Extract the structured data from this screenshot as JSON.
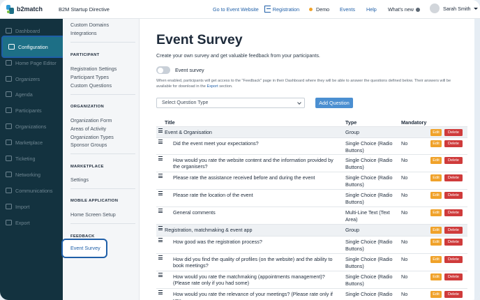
{
  "header": {
    "brand": "b2match",
    "event_name": "B2M Startup Directive",
    "go_to_event": "Go to Event Website",
    "registration": "Registration",
    "demo": "Demo",
    "events": "Events",
    "help": "Help",
    "whats_new": "What's new",
    "user_name": "Sarah Smith"
  },
  "sidebar": {
    "items": [
      {
        "label": "Dashboard",
        "icon": "dashboard-icon"
      },
      {
        "label": "Configuration",
        "icon": "gear-icon",
        "active": true
      },
      {
        "label": "Home Page Editor",
        "icon": "home-icon"
      },
      {
        "label": "Organizers",
        "icon": "people-icon"
      },
      {
        "label": "Agenda",
        "icon": "calendar-icon"
      },
      {
        "label": "Participants",
        "icon": "participants-icon"
      },
      {
        "label": "Organizations",
        "icon": "building-icon"
      },
      {
        "label": "Marketplace",
        "icon": "marketplace-icon"
      },
      {
        "label": "Ticketing",
        "icon": "ticket-icon"
      },
      {
        "label": "Networking",
        "icon": "networking-icon"
      },
      {
        "label": "Communications",
        "icon": "chat-icon"
      },
      {
        "label": "Import",
        "icon": "import-icon"
      },
      {
        "label": "Export",
        "icon": "export-icon"
      }
    ]
  },
  "subnav": {
    "custom_domains": "Custom Domains",
    "integrations": "Integrations",
    "participant_head": "PARTICIPANT",
    "registration_settings": "Registration Settings",
    "participant_types": "Participant Types",
    "custom_questions": "Custom Questions",
    "organization_head": "ORGANIZATION",
    "organization_form": "Organization Form",
    "areas_of_activity": "Areas of Activity",
    "organization_types": "Organization Types",
    "sponsor_groups": "Sponsor Groups",
    "marketplace_head": "MARKETPLACE",
    "settings": "Settings",
    "mobile_head": "MOBILE APPLICATION",
    "home_screen_setup": "Home Screen Setup",
    "feedback_head": "FEEDBACK",
    "event_survey": "Event Survey"
  },
  "main": {
    "title": "Event Survey",
    "subtitle": "Create your own survey and get valuable feedback from your participants.",
    "toggle_label": "Event survey",
    "help_text_before": "When enabled, participants will get access to the \"Feedback\" page in their Dashboard where they will be able to answer the questions defined below. Their answers will be available for download in the ",
    "help_text_link": "Export",
    "help_text_after": " section.",
    "select_placeholder": "Select Question Type",
    "add_question": "Add Question",
    "columns": {
      "title": "Title",
      "type": "Type",
      "mandatory": "Mandatory"
    },
    "edit_label": "Edit",
    "delete_label": "Delete",
    "rows": [
      {
        "title": "Event & Organisation",
        "type": "Group",
        "mandatory": "",
        "group": true
      },
      {
        "title": "Did the event meet your expectations?",
        "type": "Single Choice (Radio Buttons)",
        "mandatory": "No"
      },
      {
        "title": "How would you rate the website content and the information provided by the organisers?",
        "type": "Single Choice (Radio Buttons)",
        "mandatory": "No"
      },
      {
        "title": "Please rate the assistance received before and during the event",
        "type": "Single Choice (Radio Buttons)",
        "mandatory": "No"
      },
      {
        "title": "Please rate the location of the event",
        "type": "Single Choice (Radio Buttons)",
        "mandatory": "No"
      },
      {
        "title": "General comments",
        "type": "Multi-Line Text (Text Area)",
        "mandatory": "No"
      },
      {
        "title": "Registration, matchmaking & event app",
        "type": "Group",
        "mandatory": "",
        "group": true
      },
      {
        "title": "How good was the registration process?",
        "type": "Single Choice (Radio Buttons)",
        "mandatory": "No"
      },
      {
        "title": "How did you find the quality of profiles (on the website) and the ability to book meetings?",
        "type": "Single Choice (Radio Buttons)",
        "mandatory": "No"
      },
      {
        "title": "How would you rate the matchmaking (appointments management)? (Please rate only if you had some)",
        "type": "Single Choice (Radio Buttons)",
        "mandatory": "No"
      },
      {
        "title": "How would you rate the relevance of your meetings? (Please rate only if you",
        "type": "Single Choice (Radio",
        "mandatory": "No"
      }
    ]
  },
  "colors": {
    "sidebar_bg": "#13323f",
    "accent_blue": "#1f5fa8",
    "button_blue": "#4b8fd1",
    "edit_orange": "#f0a22a",
    "delete_red": "#cf3b3b"
  }
}
